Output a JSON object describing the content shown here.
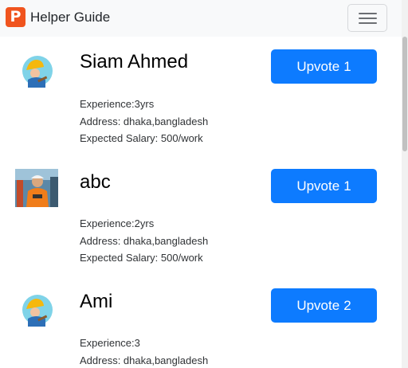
{
  "navbar": {
    "brand_letter": "P",
    "brand_text": "Helper Guide",
    "brand_color": "#f0541e"
  },
  "accent_color": "#0d7bff",
  "helpers": [
    {
      "name": "Siam Ahmed",
      "upvote_label": "Upvote",
      "upvote_count": "1",
      "experience": "Experience:3yrs",
      "address": "Address: dhaka,bangladesh",
      "salary": "Expected Salary: 500/work",
      "avatar_icon": "worker-cartoon-icon"
    },
    {
      "name": "abc",
      "upvote_label": "Upvote",
      "upvote_count": "1",
      "experience": "Experience:2yrs",
      "address": "Address: dhaka,bangladesh",
      "salary": "Expected Salary: 500/work",
      "avatar_icon": "worker-photo"
    },
    {
      "name": "Ami",
      "upvote_label": "Upvote",
      "upvote_count": "2",
      "experience": "Experience:3",
      "address": "Address: dhaka,bangladesh",
      "salary": "",
      "avatar_icon": "worker-cartoon-icon"
    }
  ]
}
